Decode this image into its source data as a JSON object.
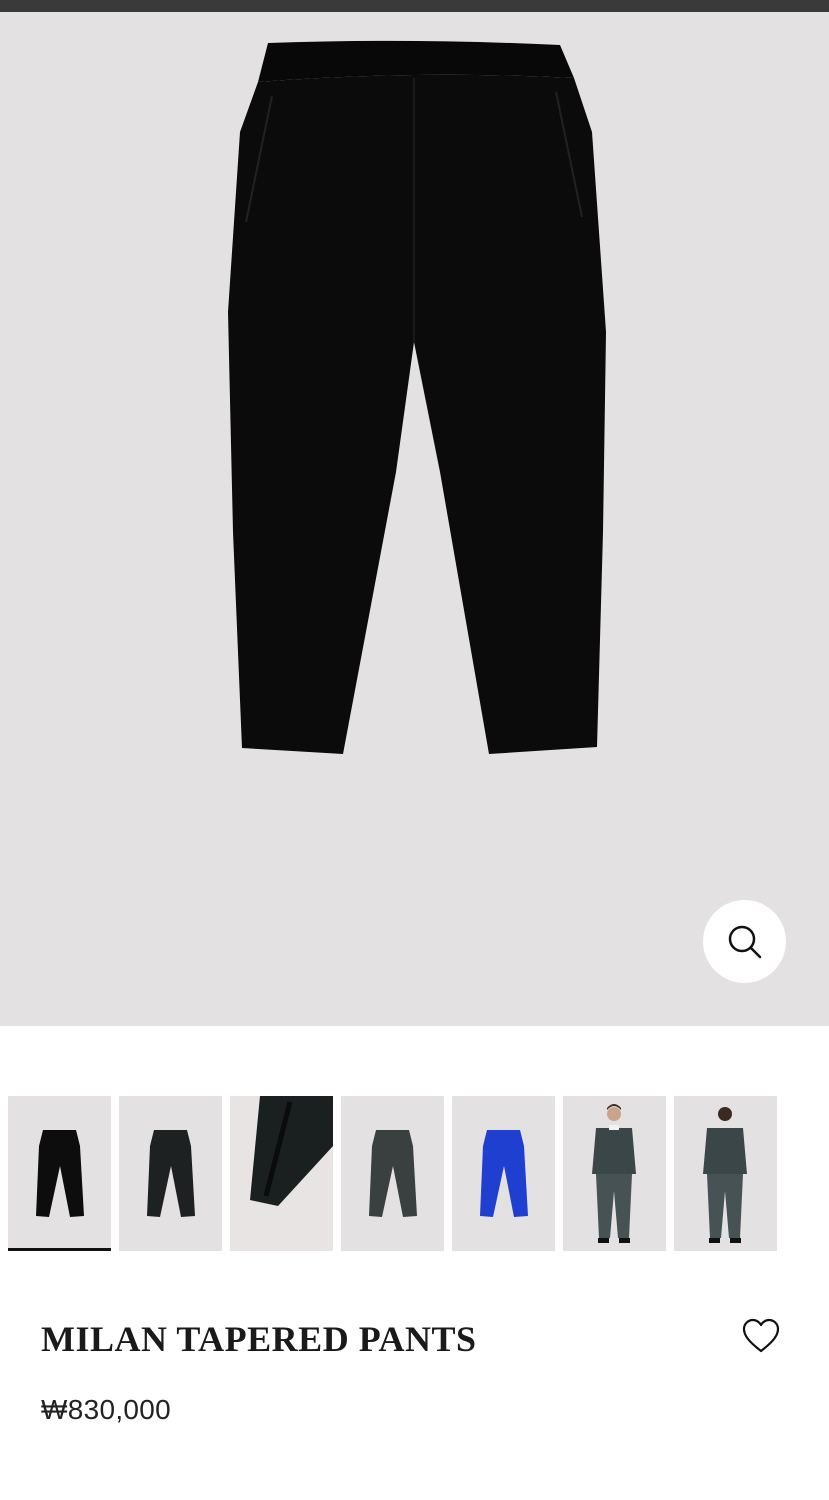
{
  "product": {
    "title": "MILAN TAPERED PANTS",
    "price": "₩830,000"
  },
  "gallery": {
    "selected_index": 0,
    "thumbnails": [
      {
        "name": "thumb-black-front",
        "color": "#0d0d0d"
      },
      {
        "name": "thumb-dark-front",
        "color": "#1e2122"
      },
      {
        "name": "thumb-detail-closeup",
        "color": "#1a1f1f"
      },
      {
        "name": "thumb-charcoal-front",
        "color": "#3a3f40"
      },
      {
        "name": "thumb-blue-front",
        "color": "#1f3fd0"
      },
      {
        "name": "thumb-model-front",
        "color": "#3b4649"
      },
      {
        "name": "thumb-model-back",
        "color": "#3b4649"
      }
    ]
  },
  "icons": {
    "zoom": "magnifier-icon",
    "wishlist": "heart-icon"
  },
  "colors": {
    "image_bg": "#e4e1e2",
    "garment": "#0b0b0b"
  }
}
